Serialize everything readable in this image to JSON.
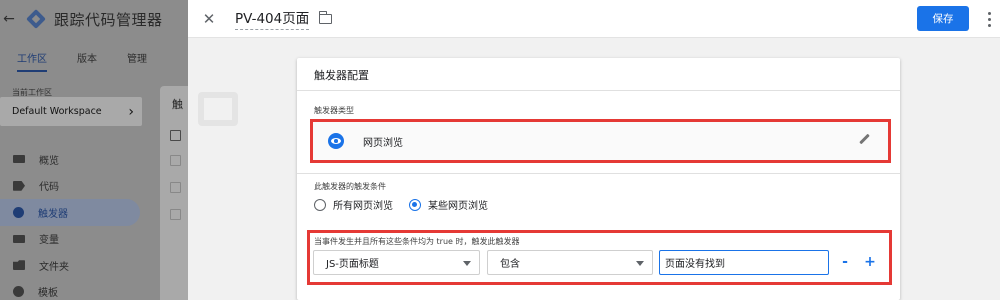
{
  "app": {
    "back_icon": "arrow-left-icon",
    "logo_icon": "gtm-logo-icon",
    "title": "跟踪代码管理器",
    "tabs": [
      {
        "label": "工作区",
        "active": true
      },
      {
        "label": "版本",
        "active": false
      },
      {
        "label": "管理",
        "active": false
      }
    ],
    "workspace_label": "当前工作区",
    "workspace_name": "Default Workspace",
    "workspace_chevron": "›",
    "nav": [
      {
        "label": "概览",
        "icon": "briefcase-icon",
        "active": false
      },
      {
        "label": "代码",
        "icon": "tag-icon",
        "active": false
      },
      {
        "label": "触发器",
        "icon": "trigger-icon",
        "active": true
      },
      {
        "label": "变量",
        "icon": "variable-icon",
        "active": false
      },
      {
        "label": "文件夹",
        "icon": "folder-icon",
        "active": false
      },
      {
        "label": "模板",
        "icon": "template-icon",
        "active": false
      }
    ],
    "list_panel_title": "触"
  },
  "drawer": {
    "close_icon": "close-icon",
    "close_glyph": "✕",
    "title": "PV-404页面",
    "folder_icon": "folder-icon",
    "save_label": "保存",
    "more_icon": "more-vert-icon",
    "accent": "#1a73e8"
  },
  "card": {
    "title": "触发器配置",
    "type_label": "触发器类型",
    "type_icon": "eye-icon",
    "type_name": "网页浏览",
    "edit_icon": "pencil-icon",
    "fires_on_label": "此触发器的触发条件",
    "fires_on_options": [
      {
        "label": "所有网页浏览",
        "selected": false
      },
      {
        "label": "某些网页浏览",
        "selected": true
      }
    ],
    "condition_label": "当事件发生并且所有这些条件均为 true 时，触发此触发器",
    "condition": {
      "variable": "JS-页面标题",
      "operator": "包含",
      "value": "页面没有找到",
      "remove_label": "-",
      "add_label": "+"
    },
    "highlight_color": "#e53935"
  }
}
